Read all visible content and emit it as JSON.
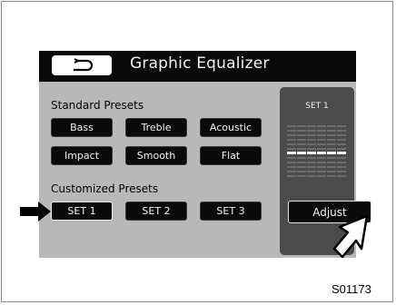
{
  "header": {
    "title": "Graphic Equalizer",
    "back_icon": "return-arrow-icon"
  },
  "standard_presets": {
    "label": "Standard Presets",
    "buttons": [
      "Bass",
      "Treble",
      "Acoustic",
      "Impact",
      "Smooth",
      "Flat"
    ]
  },
  "customized_presets": {
    "label": "Customized Presets",
    "buttons": [
      "SET 1",
      "SET 2",
      "SET 3"
    ],
    "selected": "SET 1"
  },
  "equalizer": {
    "current_set": "SET 1",
    "adjust_label": "Adjust"
  },
  "figure_id": "S01173",
  "colors": {
    "screen_bg": "#b8b8b8",
    "button_bg": "#0a0a0a",
    "panel_bg": "#4b4b4b"
  }
}
